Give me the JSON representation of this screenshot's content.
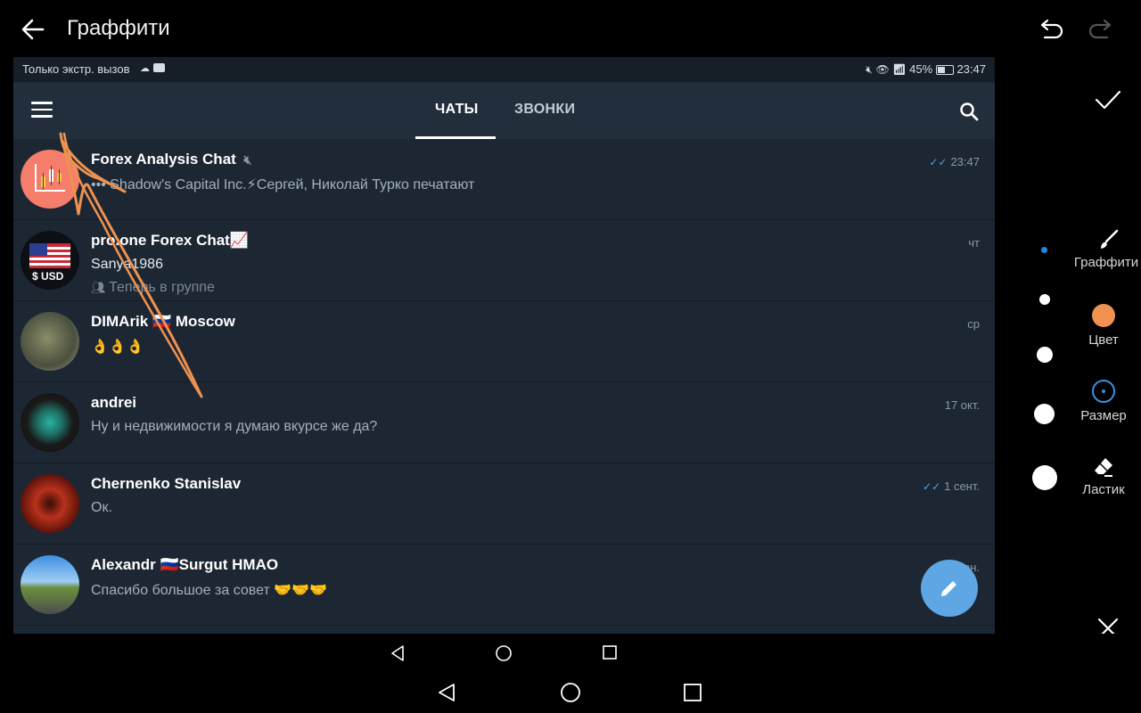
{
  "editor": {
    "title": "Граффити",
    "tools": [
      {
        "label": "Граффити",
        "icon": "brush-icon"
      },
      {
        "label": "Цвет",
        "icon": "color-swatch-icon"
      },
      {
        "label": "Размер",
        "icon": "size-icon"
      },
      {
        "label": "Ластик",
        "icon": "eraser-icon"
      }
    ],
    "colors": {
      "accent": "#f0924f",
      "size_ring": "#3a8fe0",
      "selected_dot": "#1e88e5"
    }
  },
  "status_bar": {
    "left": "Только экстр. вызов",
    "battery": "45%",
    "clock": "23:47"
  },
  "app": {
    "tabs": [
      "ЧАТЫ",
      "ЗВОНКИ"
    ],
    "active_tab": "ЧАТЫ",
    "chats": [
      {
        "name": "Forex Analysis Chat",
        "muted": true,
        "time": "23:47",
        "read": true,
        "message": "••• Shadow's Capital Inc.⚡Сергей, Николай Турко печатают",
        "message2": ""
      },
      {
        "name": "pro.one Forex Chat📈",
        "muted": false,
        "time": "чт",
        "read": false,
        "message": "Sanya1986",
        "message2": "Теперь в группе"
      },
      {
        "name": "DIMArik 🇷🇺 Moscow",
        "muted": false,
        "time": "ср",
        "read": false,
        "message": "👌👌👌",
        "message2": ""
      },
      {
        "name": "andrei",
        "muted": false,
        "time": "17 окт.",
        "read": false,
        "message": "Ну и недвижимости я думаю вкурсе же да?",
        "message2": ""
      },
      {
        "name": "Chernenko Stanislav",
        "muted": false,
        "time": "1 сент.",
        "read": true,
        "message": "Ок.",
        "message2": ""
      },
      {
        "name": "Alexandr 🇷🇺Surgut HMAO",
        "muted": false,
        "time": "8 июн.",
        "read": false,
        "message": "Спасибо большое за совет 🤝🤝🤝",
        "message2": ""
      }
    ],
    "usd_badge": "$ USD"
  }
}
